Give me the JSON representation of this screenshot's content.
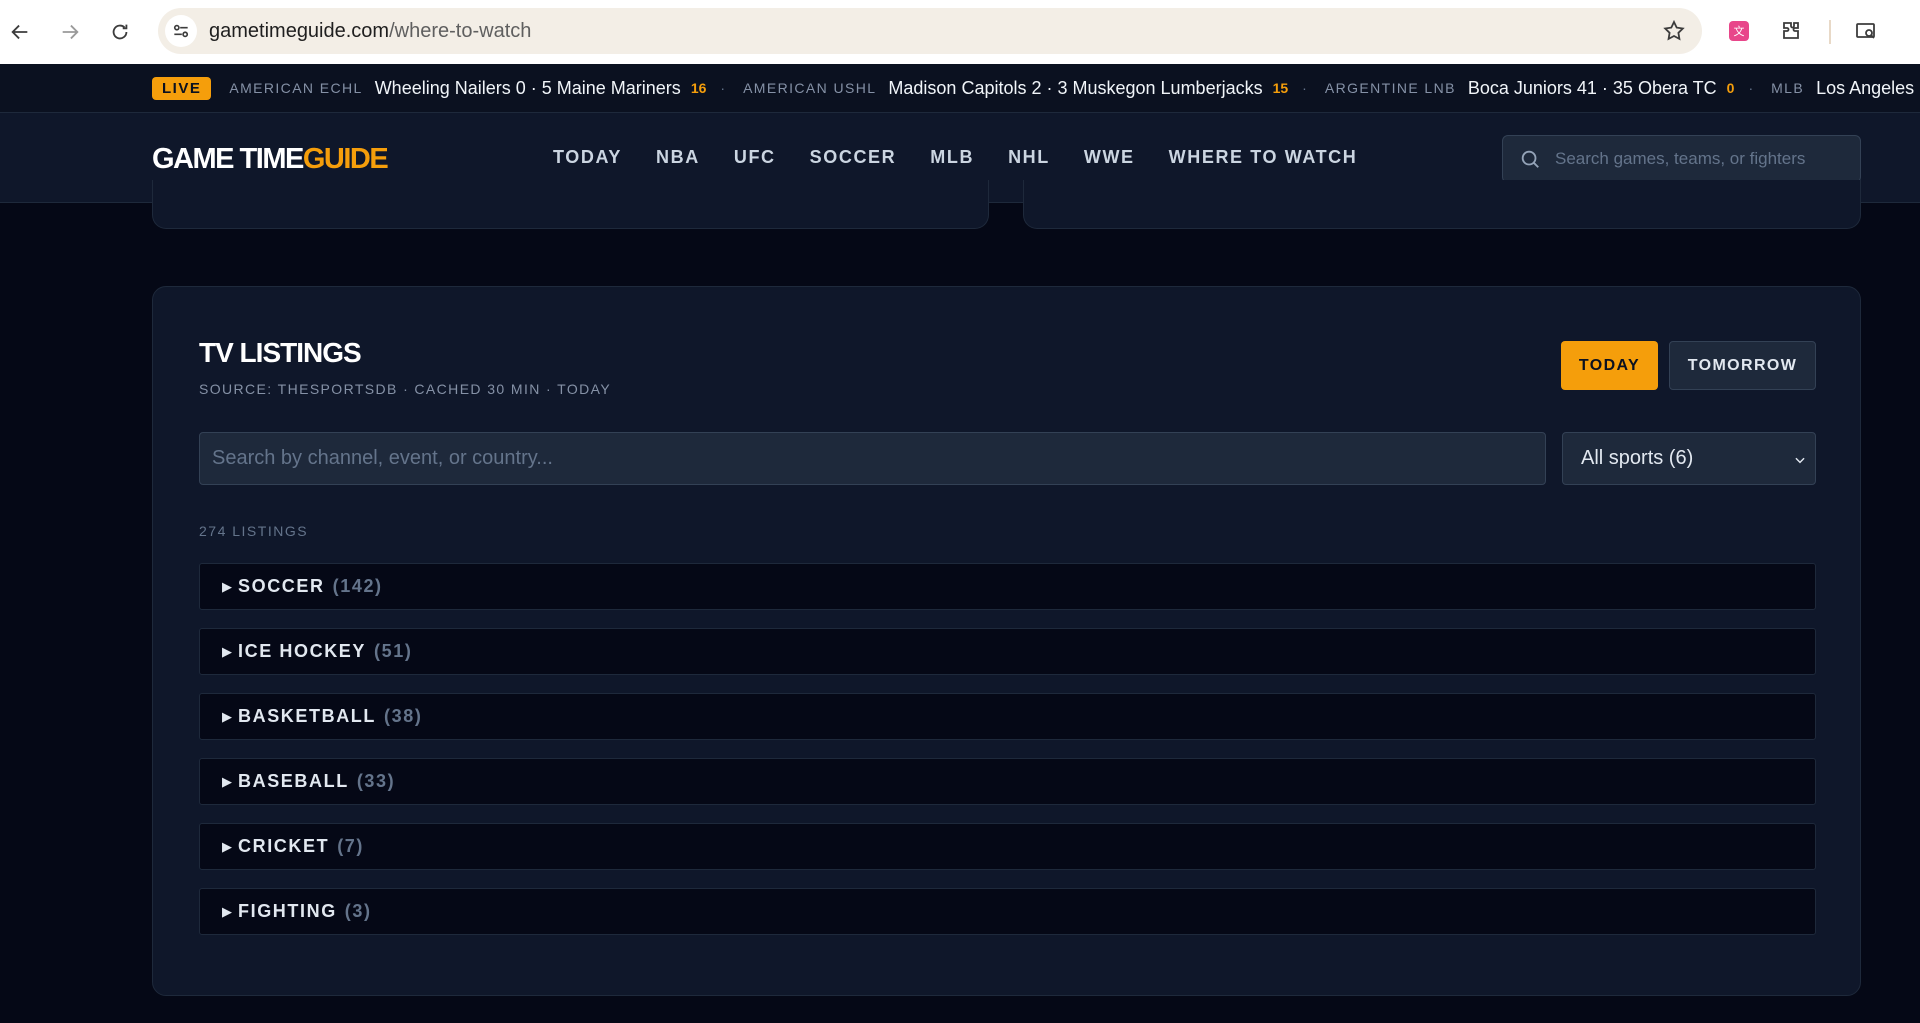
{
  "browser": {
    "url_host": "gametimeguide.com",
    "url_path": "/where-to-watch"
  },
  "ticker": {
    "live_label": "LIVE",
    "items": [
      {
        "league": "AMERICAN ECHL",
        "score": "Wheeling Nailers 0 · 5 Maine Mariners",
        "minute": "16"
      },
      {
        "league": "AMERICAN USHL",
        "score": "Madison Capitols 2 · 3 Muskegon Lumberjacks",
        "minute": "15"
      },
      {
        "league": "ARGENTINE LNB",
        "score": "Boca Juniors 41 · 35 Obera TC",
        "minute": "0"
      },
      {
        "league": "MLB",
        "score": "Los Angeles",
        "minute": ""
      }
    ]
  },
  "header": {
    "logo_main": "GAME TIME",
    "logo_accent": "GUIDE",
    "nav": [
      "TODAY",
      "NBA",
      "UFC",
      "SOCCER",
      "MLB",
      "NHL",
      "WWE",
      "WHERE TO WATCH"
    ],
    "search_placeholder": "Search games, teams, or fighters"
  },
  "listings": {
    "title": "TV LISTINGS",
    "subtitle": "SOURCE: THESPORTSDB · CACHED 30 MIN · TODAY",
    "today_label": "TODAY",
    "tomorrow_label": "TOMORROW",
    "search_placeholder": "Search by channel, event, or country...",
    "sport_filter": "All sports (6)",
    "count_label": "274 LISTINGS",
    "groups": [
      {
        "name": "SOCCER",
        "count": "(142)"
      },
      {
        "name": "ICE HOCKEY",
        "count": "(51)"
      },
      {
        "name": "BASKETBALL",
        "count": "(38)"
      },
      {
        "name": "BASEBALL",
        "count": "(33)"
      },
      {
        "name": "CRICKET",
        "count": "(7)"
      },
      {
        "name": "FIGHTING",
        "count": "(3)"
      }
    ]
  },
  "colors": {
    "accent": "#f59e0b",
    "background": "#050816",
    "panel": "#0f172a"
  }
}
